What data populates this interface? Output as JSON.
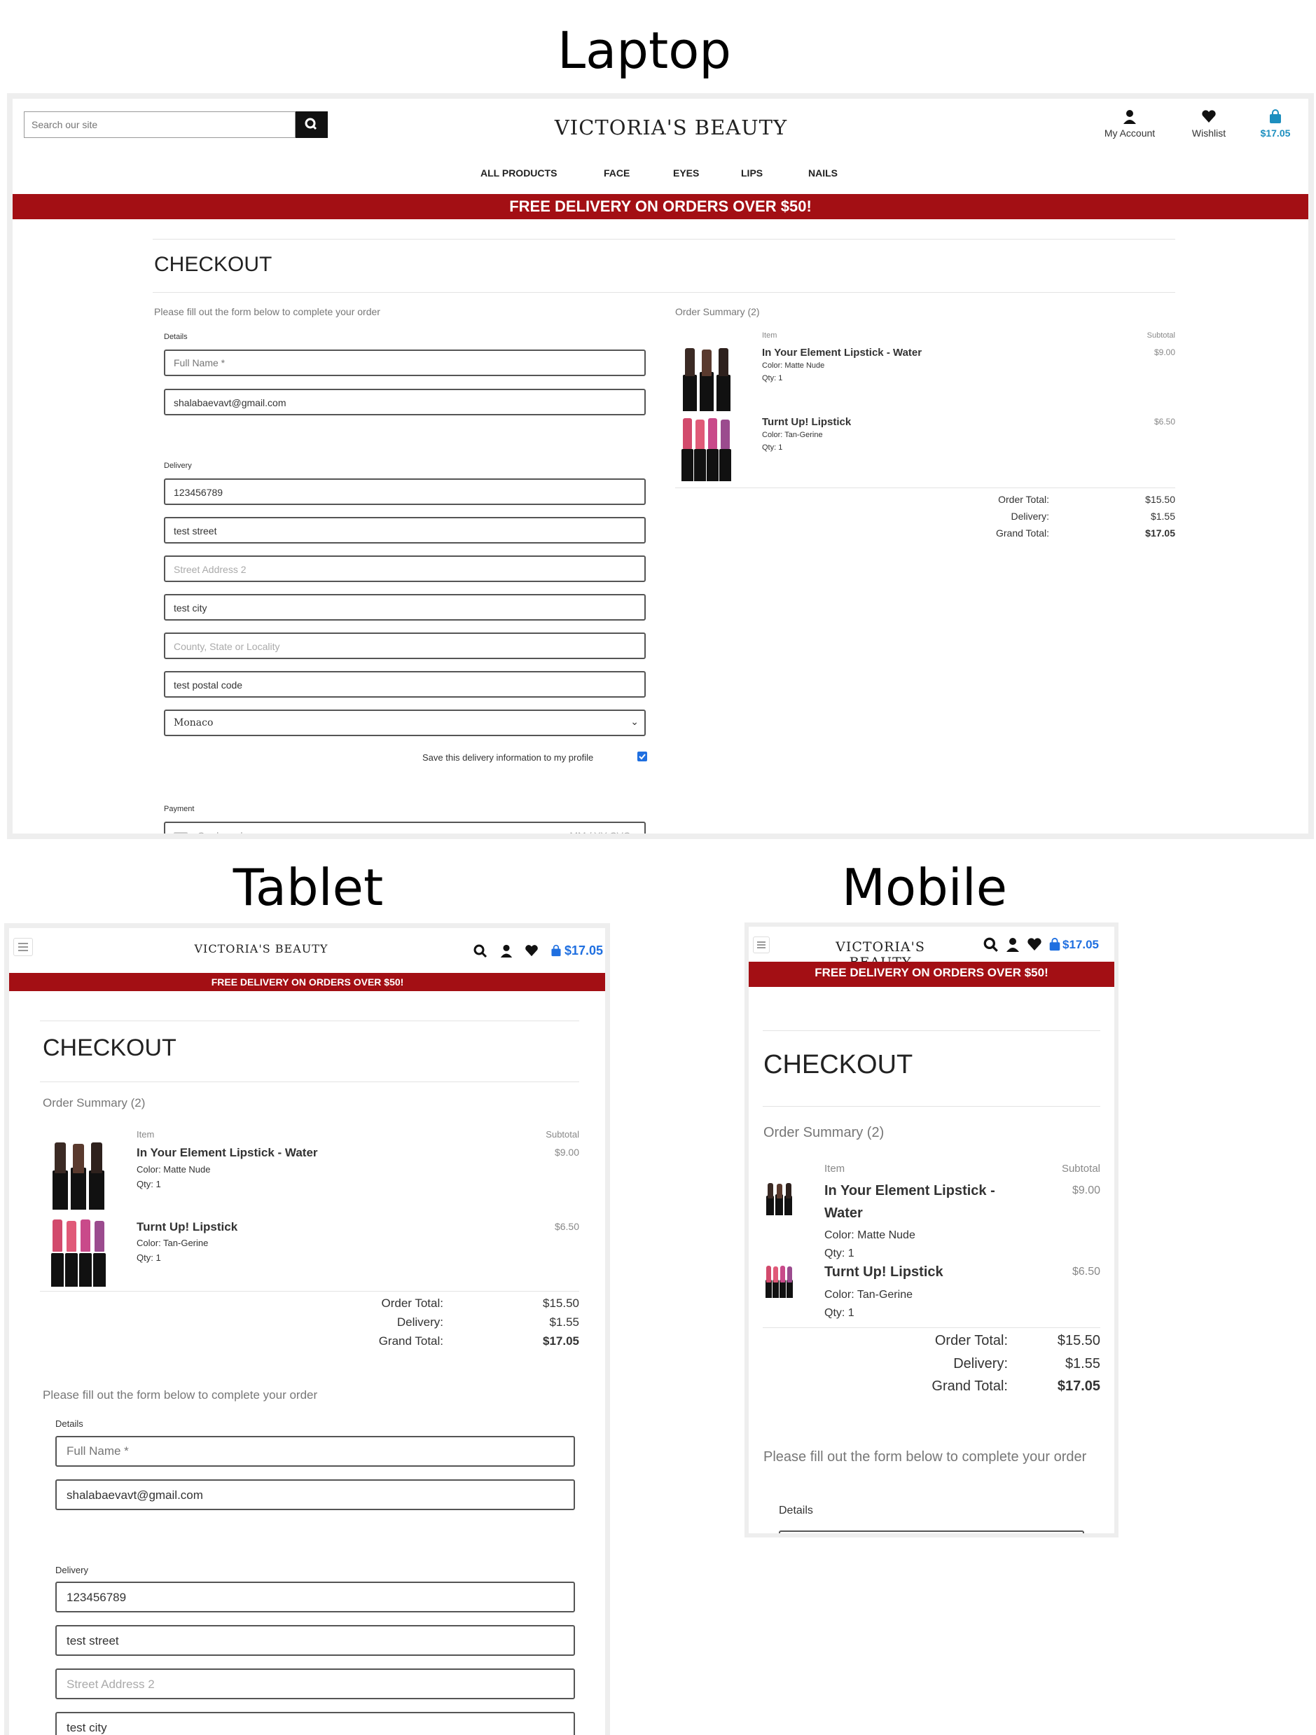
{
  "captions": {
    "laptop": "Laptop",
    "tablet": "Tablet",
    "mobile": "Mobile"
  },
  "brand": "VICTORIA'S BEAUTY",
  "search": {
    "placeholder": "Search our site"
  },
  "account": {
    "my_account": "My Account",
    "wishlist": "Wishlist",
    "bag_total": "$17.05"
  },
  "nav": [
    "ALL PRODUCTS",
    "FACE",
    "EYES",
    "LIPS",
    "NAILS"
  ],
  "banner": "FREE DELIVERY ON ORDERS OVER $50!",
  "page_title": "CHECKOUT",
  "form": {
    "intro": "Please fill out the form below to complete your order",
    "details_label": "Details",
    "full_name_placeholder": "Full Name *",
    "email_value": "shalabaevavt@gmail.com",
    "delivery_label": "Delivery",
    "phone_value": "123456789",
    "street1_value": "test street",
    "street2_placeholder": "Street Address 2",
    "city_value": "test city",
    "county_placeholder": "County, State or Locality",
    "postcode_value": "test postal code",
    "country_value": "Monaco",
    "save_label": "Save this delivery information to my profile",
    "payment_label": "Payment",
    "card_placeholder": "Card number",
    "card_expiry_cvc": "MM / YY  CVC",
    "city_partial": "test city"
  },
  "summary": {
    "title": "Order Summary (2)",
    "item_header": "Item",
    "subtotal_header": "Subtotal",
    "items": [
      {
        "name": "In Your Element Lipstick - Water",
        "name_line1": "In Your Element Lipstick -",
        "name_line2": "Water",
        "color": "Color: Matte Nude",
        "qty": "Qty: 1",
        "subtotal": "$9.00"
      },
      {
        "name": "Turnt Up! Lipstick",
        "color": "Color: Tan-Gerine",
        "qty": "Qty: 1",
        "subtotal": "$6.50"
      }
    ],
    "order_total_label": "Order Total:",
    "order_total": "$15.50",
    "delivery_label": "Delivery:",
    "delivery": "$1.55",
    "grand_total_label": "Grand Total:",
    "grand_total": "$17.05"
  },
  "colors": {
    "banner": "#a30f14",
    "accent": "#1f6fe0",
    "nude": [
      "#3b2a24",
      "#5a3a2e",
      "#2e211d"
    ],
    "tangerine": [
      "#d24a6c",
      "#e05a78",
      "#c94a8a",
      "#9b4b8e"
    ]
  },
  "icons": [
    "search-icon",
    "user-icon",
    "heart-icon",
    "shopping-bag-icon",
    "hamburger-menu-icon",
    "chevron-down-icon",
    "card-icon",
    "checkbox-checked-icon"
  ]
}
